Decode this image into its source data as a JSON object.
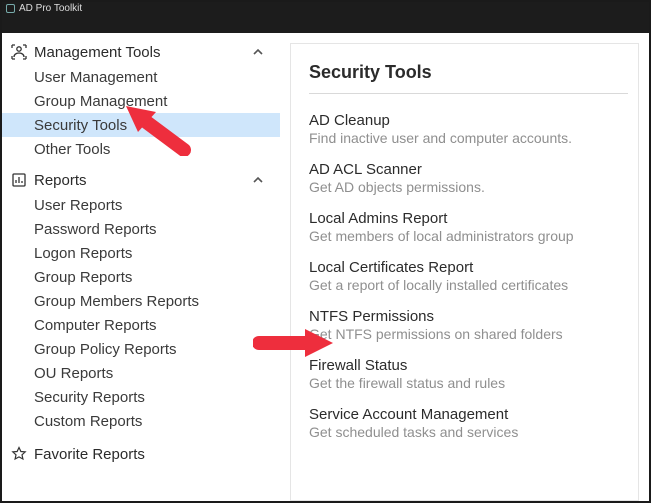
{
  "window": {
    "title": "AD Pro Toolkit"
  },
  "sidebar": {
    "groups": [
      {
        "label": "Management Tools",
        "icon": "mgmt-icon",
        "expanded": true,
        "items": [
          {
            "label": "User Management",
            "selected": false
          },
          {
            "label": "Group Management",
            "selected": false
          },
          {
            "label": "Security Tools",
            "selected": true
          },
          {
            "label": "Other Tools",
            "selected": false
          }
        ]
      },
      {
        "label": "Reports",
        "icon": "reports-icon",
        "expanded": true,
        "items": [
          {
            "label": "User Reports"
          },
          {
            "label": "Password Reports"
          },
          {
            "label": "Logon Reports"
          },
          {
            "label": "Group Reports"
          },
          {
            "label": "Group Members Reports"
          },
          {
            "label": "Computer Reports"
          },
          {
            "label": "Group Policy Reports"
          },
          {
            "label": "OU Reports"
          },
          {
            "label": "Security Reports"
          },
          {
            "label": "Custom Reports"
          }
        ]
      }
    ],
    "favorites": {
      "label": "Favorite Reports",
      "icon": "star-icon"
    }
  },
  "main": {
    "heading": "Security Tools",
    "tools": [
      {
        "title": "AD Cleanup",
        "desc": "Find inactive user and computer accounts."
      },
      {
        "title": "AD ACL Scanner",
        "desc": "Get AD objects permissions."
      },
      {
        "title": "Local Admins Report",
        "desc": "Get members of local administrators group"
      },
      {
        "title": "Local Certificates Report",
        "desc": "Get a report of locally installed certificates"
      },
      {
        "title": "NTFS Permissions",
        "desc": "Get NTFS permissions on shared folders"
      },
      {
        "title": "Firewall Status",
        "desc": "Get the firewall status and rules"
      },
      {
        "title": "Service Account Management",
        "desc": "Get scheduled tasks and services"
      }
    ]
  },
  "annotations": {
    "arrow1_target": "Security Tools nav item",
    "arrow2_target": "NTFS Permissions tool"
  }
}
